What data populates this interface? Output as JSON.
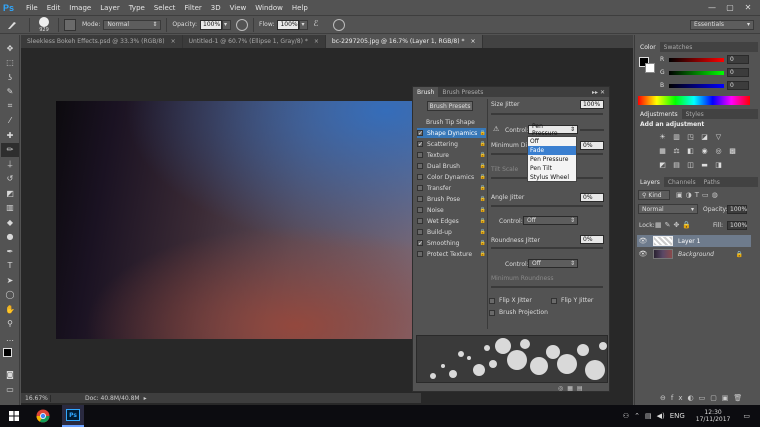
{
  "app": {
    "logo": "Ps"
  },
  "menu": [
    "File",
    "Edit",
    "Image",
    "Layer",
    "Type",
    "Select",
    "Filter",
    "3D",
    "View",
    "Window",
    "Help"
  ],
  "window_controls": [
    "—",
    "▢",
    "✕"
  ],
  "options_bar": {
    "brush_size": "929",
    "mode_label": "Mode:",
    "mode_value": "Normal",
    "opacity_label": "Opacity:",
    "opacity_value": "100%",
    "flow_label": "Flow:",
    "flow_value": "100%",
    "workspace": "Essentials"
  },
  "doc_tabs": [
    {
      "label": "Sleekless Bokeh Effects.psd @ 33.3% (RGB/8)",
      "close": "×"
    },
    {
      "label": "Untitled-1 @ 60.7% (Ellipse 1, Gray/8) *",
      "close": "×"
    },
    {
      "label": "bc-2297205.jpg @ 16.7% (Layer 1, RGB/8) *",
      "close": "×"
    }
  ],
  "status": {
    "zoom": "16.67%",
    "doc": "Doc: 40.8M/40.8M"
  },
  "brush_panel": {
    "tabs": [
      "Brush",
      "Brush Presets"
    ],
    "presets_button": "Brush Presets",
    "brush_tip_shape": "Brush Tip Shape",
    "items": [
      {
        "label": "Shape Dynamics",
        "checked": true,
        "selected": true
      },
      {
        "label": "Scattering",
        "checked": true
      },
      {
        "label": "Texture",
        "checked": false
      },
      {
        "label": "Dual Brush",
        "checked": false
      },
      {
        "label": "Color Dynamics",
        "checked": false
      },
      {
        "label": "Transfer",
        "checked": false
      },
      {
        "label": "Brush Pose",
        "checked": false
      },
      {
        "label": "Noise",
        "checked": false
      },
      {
        "label": "Wet Edges",
        "checked": false
      },
      {
        "label": "Build-up",
        "checked": false
      },
      {
        "label": "Smoothing",
        "checked": true
      },
      {
        "label": "Protect Texture",
        "checked": false
      }
    ],
    "size_jitter_label": "Size Jitter",
    "size_jitter_value": "100%",
    "control_label": "Control:",
    "control_value": "Pen Pressure",
    "dropdown_options": [
      "Off",
      "Fade",
      "Pen Pressure",
      "Pen Tilt",
      "Stylus Wheel"
    ],
    "dropdown_highlight": "Fade",
    "min_diameter_label": "Minimum Diam",
    "min_diameter_value": "0%",
    "tilt_scale_label": "Tilt Scale",
    "angle_jitter_label": "Angle Jitter",
    "angle_jitter_value": "0%",
    "angle_control_value": "Off",
    "roundness_jitter_label": "Roundness Jitter",
    "roundness_jitter_value": "0%",
    "roundness_control_value": "Off",
    "min_roundness_label": "Minimum Roundness",
    "flip_x": "Flip X Jitter",
    "flip_y": "Flip Y Jitter",
    "brush_projection": "Brush Projection"
  },
  "color_panel": {
    "tabs": [
      "Color",
      "Swatches"
    ],
    "channels": [
      {
        "name": "R",
        "value": "0"
      },
      {
        "name": "G",
        "value": "0"
      },
      {
        "name": "B",
        "value": "0"
      }
    ]
  },
  "adjustments_panel": {
    "tabs": [
      "Adjustments",
      "Styles"
    ],
    "title": "Add an adjustment"
  },
  "layers_panel": {
    "tabs": [
      "Layers",
      "Channels",
      "Paths"
    ],
    "kind": "Kind",
    "blend_mode": "Normal",
    "opacity_label": "Opacity:",
    "opacity_value": "100%",
    "lock_label": "Lock:",
    "fill_label": "Fill:",
    "fill_value": "100%",
    "layers": [
      {
        "name": "Layer 1",
        "selected": true
      },
      {
        "name": "Background",
        "selected": false
      }
    ]
  },
  "taskbar": {
    "lang": "ENG",
    "time": "12:30",
    "date": "17/11/2017"
  },
  "colors": {
    "ui_bg": "#535353",
    "selection": "#3878b8",
    "ps_blue": "#30a8ff"
  }
}
